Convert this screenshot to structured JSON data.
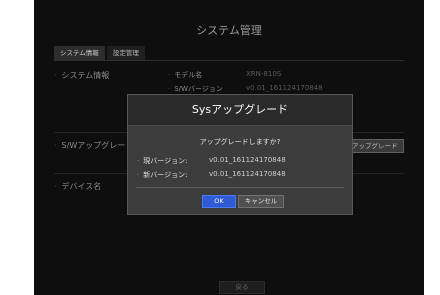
{
  "window": {
    "title": "システム管理"
  },
  "tabs": [
    {
      "label": "システム情報"
    },
    {
      "label": "設定管理"
    }
  ],
  "system_info": {
    "section_label": "システム情報",
    "model_label": "モデル名",
    "model_value": "XRN-810S",
    "sw_version_label": "S/Wバージョン",
    "sw_version_value": "v0.01_161124170848"
  },
  "sw_upgrade": {
    "section_label": "S/Wアップグレード",
    "button_label": "アップグレード"
  },
  "device_name": {
    "section_label": "デバイス名"
  },
  "footer": {
    "back_label": "戻る"
  },
  "dialog": {
    "title": "Sysアップグレード",
    "question": "アップグレードしますか?",
    "current_label": "現バージョン:",
    "current_value": "v0.01_161124170848",
    "new_label": "新バージョン:",
    "new_value": "v0.01_161124170848",
    "ok_label": "OK",
    "cancel_label": "キャンセル"
  }
}
